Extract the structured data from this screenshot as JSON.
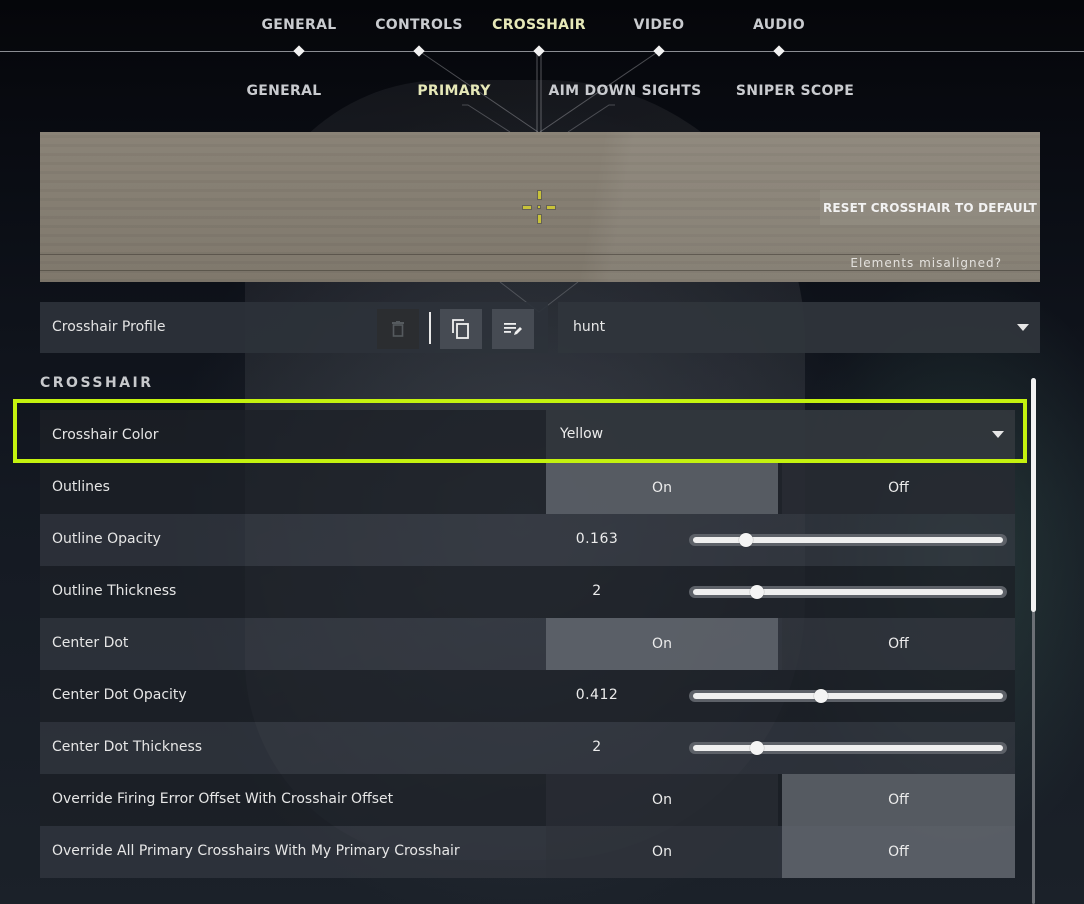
{
  "top_tabs": [
    {
      "label": "GENERAL",
      "active": false
    },
    {
      "label": "CONTROLS",
      "active": false
    },
    {
      "label": "CROSSHAIR",
      "active": true
    },
    {
      "label": "VIDEO",
      "active": false
    },
    {
      "label": "AUDIO",
      "active": false
    }
  ],
  "sub_tabs": [
    {
      "label": "GENERAL",
      "active": false
    },
    {
      "label": "PRIMARY",
      "active": true
    },
    {
      "label": "AIM DOWN SIGHTS",
      "active": false
    },
    {
      "label": "SNIPER SCOPE",
      "active": false
    }
  ],
  "preview": {
    "reset_label": "RESET CROSSHAIR TO DEFAULT",
    "misaligned_label": "Elements misaligned?",
    "crosshair_color": "#c8c23a"
  },
  "profile": {
    "label": "Crosshair Profile",
    "delete_icon": "trash-icon",
    "copy_icon": "copy-icon",
    "edit_icon": "rename-icon",
    "selected": "hunt"
  },
  "section_title": "CROSSHAIR",
  "highlight_color": "#c4f20f",
  "settings": [
    {
      "label": "Crosshair Color",
      "type": "select",
      "value": "Yellow"
    },
    {
      "label": "Outlines",
      "type": "toggle",
      "on_label": "On",
      "off_label": "Off",
      "value": "On"
    },
    {
      "label": "Outline Opacity",
      "type": "slider",
      "display": "0.163",
      "fraction": 0.163
    },
    {
      "label": "Outline Thickness",
      "type": "slider",
      "display": "2",
      "fraction": 0.2
    },
    {
      "label": "Center Dot",
      "type": "toggle",
      "on_label": "On",
      "off_label": "Off",
      "value": "On"
    },
    {
      "label": "Center Dot Opacity",
      "type": "slider",
      "display": "0.412",
      "fraction": 0.412
    },
    {
      "label": "Center Dot Thickness",
      "type": "slider",
      "display": "2",
      "fraction": 0.2
    },
    {
      "label": "Override Firing Error Offset With Crosshair Offset",
      "type": "toggle",
      "on_label": "On",
      "off_label": "Off",
      "value": "Off"
    },
    {
      "label": "Override All Primary Crosshairs With My Primary Crosshair",
      "type": "toggle",
      "on_label": "On",
      "off_label": "Off",
      "value": "Off"
    }
  ],
  "scrollbar": {
    "position_fraction": 0.0,
    "visible_fraction": 0.45
  }
}
